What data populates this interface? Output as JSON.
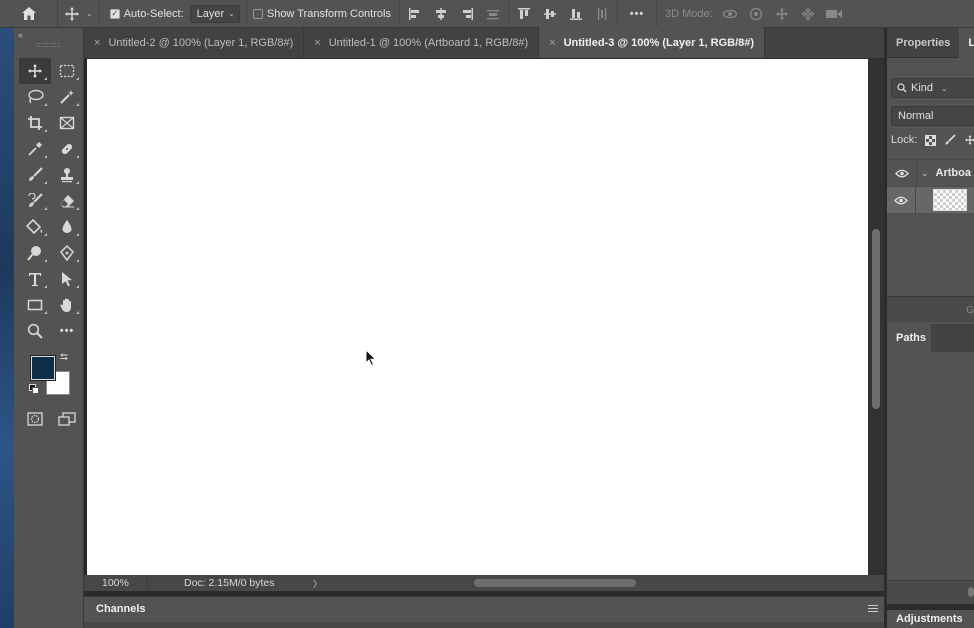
{
  "options_bar": {
    "auto_select_label": "Auto-Select:",
    "auto_select_checked": true,
    "layer_select_value": "Layer",
    "show_transform_label": "Show Transform Controls",
    "show_transform_checked": false,
    "more_label": "•••",
    "mode_3d_label": "3D Mode:"
  },
  "tabs": [
    {
      "label": "Untitled-2 @ 100% (Layer 1, RGB/8#)",
      "active": false
    },
    {
      "label": "Untitled-1 @ 100% (Artboard 1, RGB/8#)",
      "active": false
    },
    {
      "label": "Untitled-3 @ 100% (Layer 1, RGB/8#)",
      "active": true
    }
  ],
  "tab_close_glyph": "×",
  "toolbar": {
    "more_tools_label": "•••",
    "foreground_color": "#0e2f45",
    "background_color": "#ffffff"
  },
  "status": {
    "zoom": "100%",
    "doc_info": "Doc: 2.15M/0 bytes",
    "arrow": "〉"
  },
  "channels_panel": {
    "title": "Channels"
  },
  "right_panel": {
    "tabs": [
      {
        "label": "Properties"
      },
      {
        "label": "L"
      }
    ],
    "kind_label": "Kind",
    "blend_mode": "Normal",
    "lock_label": "Lock:",
    "layers": [
      {
        "name": "Artboa",
        "type": "artboard"
      },
      {
        "name": "",
        "type": "layer",
        "selected": true
      }
    ],
    "layers_footer_glyph": "G",
    "paths_title": "Paths",
    "adjustments_title": "Adjustments"
  }
}
